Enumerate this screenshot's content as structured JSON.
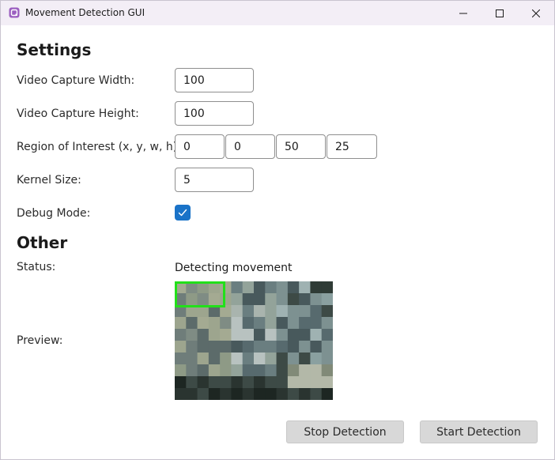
{
  "window": {
    "title": "Movement Detection GUI",
    "app_icon": "app-icon",
    "controls": [
      "minimize-icon",
      "maximize-icon",
      "close-icon"
    ]
  },
  "settings": {
    "heading": "Settings",
    "width_label": "Video Capture Width:",
    "width_value": "100",
    "height_label": "Video Capture Height:",
    "height_value": "100",
    "roi_label": "Region of Interest (x, y, w, h):",
    "roi_x": "0",
    "roi_y": "0",
    "roi_w": "50",
    "roi_h": "25",
    "kernel_label": "Kernel Size:",
    "kernel_value": "5",
    "debug_label": "Debug Mode:",
    "debug_checked": true
  },
  "other": {
    "heading": "Other",
    "status_label": "Status:",
    "status_value": "Detecting movement",
    "preview_label": "Preview:"
  },
  "buttons": {
    "stop": "Stop Detection",
    "start": "Start Detection"
  },
  "colors": {
    "accent": "#1a73c8",
    "roi_box": "#22e01a",
    "titlebar": "#f3eef6"
  }
}
